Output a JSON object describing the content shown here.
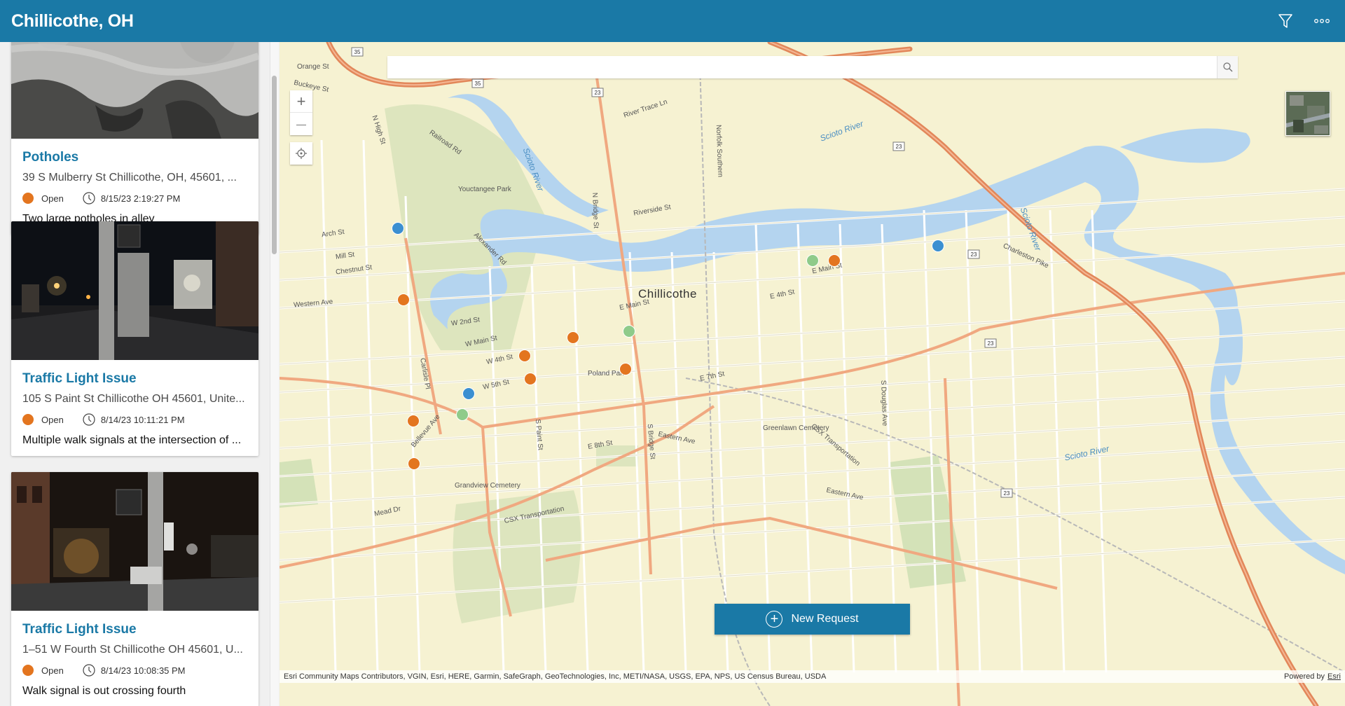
{
  "header": {
    "title": "Chillicothe, OH",
    "filter_icon": "filter-icon",
    "more_icon": "more-options-icon"
  },
  "cards": [
    {
      "title": "Potholes",
      "address": "39 S Mulberry St Chillicothe, OH, 45601, ...",
      "status": "Open",
      "status_color": "#e3751f",
      "timestamp": "8/15/23 2:19:27 PM",
      "description": "Two large potholes in alley"
    },
    {
      "title": "Traffic Light Issue",
      "address": "105 S Paint St Chillicothe OH 45601, Unite...",
      "status": "Open",
      "status_color": "#e3751f",
      "timestamp": "8/14/23 10:11:21 PM",
      "description": "Multiple walk signals at the intersection of ..."
    },
    {
      "title": "Traffic Light Issue",
      "address": "1–51 W Fourth St Chillicothe OH 45601, U...",
      "status": "Open",
      "status_color": "#e3751f",
      "timestamp": "8/14/23 10:08:35 PM",
      "description": "Walk signal is out crossing fourth"
    }
  ],
  "map": {
    "search": {
      "value": "",
      "placeholder": ""
    },
    "zoom_in": "+",
    "zoom_out": "—",
    "new_request_label": "New Request",
    "attribution": "Esri Community Maps Contributors, VGIN, Esri, HERE, Garmin, SafeGraph, GeoTechnologies, Inc, METI/NASA, USGS, EPA, NPS, US Census Bureau, USDA",
    "powered_by": "Powered by",
    "powered_by_link": "Esri",
    "city_label": "Chillicothe",
    "labels": {
      "orange_st": "Orange St",
      "buckeye_st": "Buckeye St",
      "n_high_st": "N High St",
      "railroad_rd": "Railroad Rd",
      "youctangee_park": "Youctangee Park",
      "scioto_river_1": "Scioto River",
      "scioto_river_2": "Scioto River",
      "scioto_river_3": "Scioto River",
      "scioto_river_4": "Scioto River",
      "n_bridge_st": "N Bridge St",
      "riverside_st": "Riverside St",
      "river_trace_ln": "River Trace Ln",
      "alexander_rd": "Alexander Rd",
      "e_main_st_1": "E Main St",
      "e_main_st_2": "E Main St",
      "w_main_st": "W Main St",
      "western_ave": "Western Ave",
      "w_4th_st": "W 4th St",
      "w_5th_st": "W 5th St",
      "w_2nd_st": "W 2nd St",
      "poland_park": "Poland Park",
      "eastern_ave_1": "Eastern Ave",
      "eastern_ave_2": "Eastern Ave",
      "e_8th_st": "E 8th St",
      "s_paint_st": "S Paint St",
      "s_bridge_st": "S Bridge St",
      "grandview_cemetery": "Grandview Cemetery",
      "greenlawn_cemetery": "Greenlawn Cemetery",
      "bellevue_ave": "Bellevue Ave",
      "carlisle_pl": "Carlisle Pl",
      "charleston_pike": "Charleston Pike",
      "csx_transportation_1": "CSX Transportation",
      "csx_transportation_2": "CSX Transportation",
      "s_douglas_ave": "S Douglas Ave",
      "e_7th_st": "E 7th St",
      "e_4th_st": "E 4th St",
      "chestnut_st": "Chestnut St",
      "arch_st": "Arch St",
      "mill_st": "Mill St",
      "mead_dr": "Mead Dr",
      "norfolk_southern": "Norfolk Southern",
      "hwy_35": "35",
      "hwy_23": "23"
    }
  },
  "markers": [
    {
      "category": "blue",
      "color": "#3b8fd1"
    },
    {
      "category": "orange",
      "color": "#e3751f"
    },
    {
      "category": "green",
      "color": "#8fcb8a"
    }
  ]
}
